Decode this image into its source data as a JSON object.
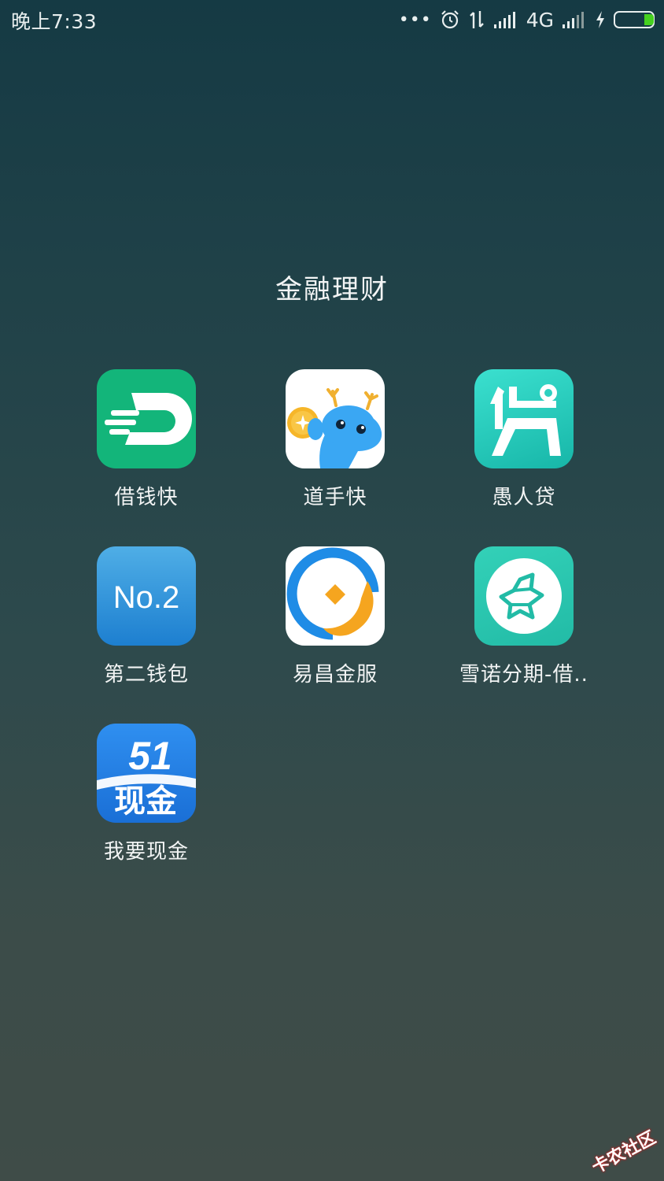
{
  "status_bar": {
    "time": "晚上7:33",
    "more": "•••",
    "network": "4G"
  },
  "folder": {
    "title": "金融理财",
    "apps": [
      {
        "name": "借钱快",
        "icon": "jieqiankuai-app-icon"
      },
      {
        "name": "道手快",
        "icon": "daoshoukuai-app-icon"
      },
      {
        "name": "愚人贷",
        "icon": "yurendai-app-icon"
      },
      {
        "name": "第二钱包",
        "icon": "dierqianbao-app-icon",
        "icon_text": "No.2"
      },
      {
        "name": "易昌金服",
        "icon": "yichangjinfu-app-icon"
      },
      {
        "name": "雪诺分期-借..",
        "icon": "xuenuofenqi-app-icon"
      },
      {
        "name": "我要现金",
        "icon": "woyaoxianjin-app-icon",
        "icon_text_top": "51",
        "icon_text_bottom": "现金"
      }
    ]
  },
  "watermark": "卡农社区",
  "colors": {
    "battery_fill": "#46d11f",
    "green_app": "#13b57a",
    "teal_app": "#2fd2c2",
    "blue_app": "#2a8cd8"
  }
}
